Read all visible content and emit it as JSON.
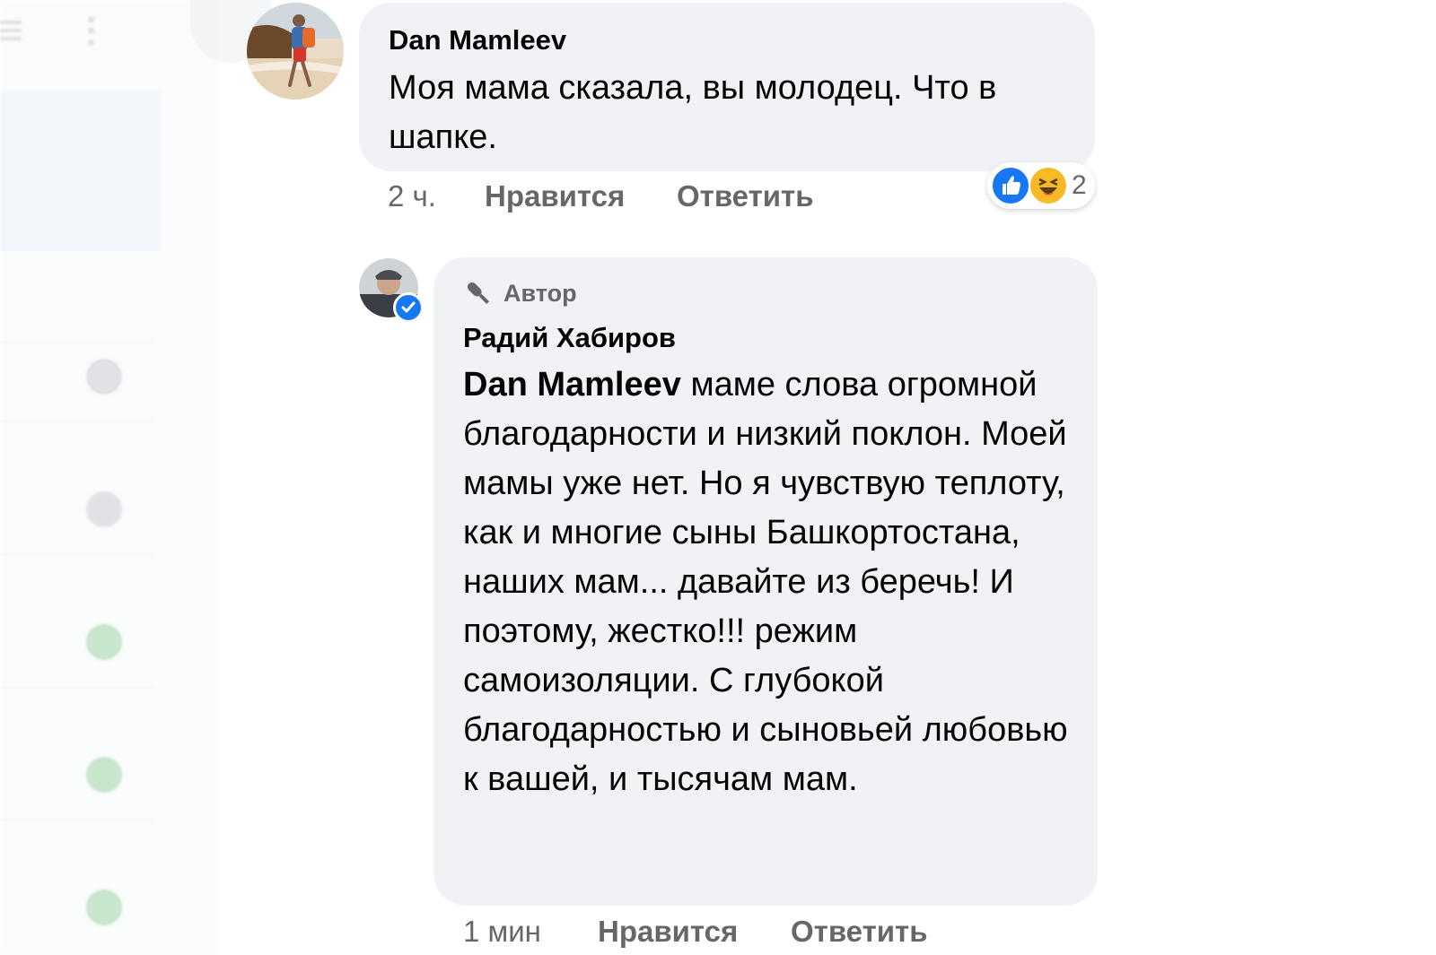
{
  "comment1": {
    "author": "Dan Mamleev",
    "text": "Моя мама сказала, вы молодец. Что в шапке.",
    "time": "2 ч.",
    "like_label": "Нравится",
    "reply_label": "Ответить",
    "reactions": {
      "icons": [
        "like-icon",
        "haha-icon"
      ],
      "count": "2"
    }
  },
  "comment2": {
    "badge": "Автор",
    "author": "Радий Хабиров",
    "mention": "Dan Mamleev",
    "text": "маме слова огромной благодарности и низкий поклон. Моей мамы уже нет. Но я чувствую теплоту, как и многие сыны Башкортостана, наших мам... давайте из беречь! И поэтому, жестко!!! режим самоизоляции. С глубокой благодарностью и сыновьей любовью к вашей, и тысячам мам.",
    "time": "1 мин",
    "like_label": "Нравится",
    "reply_label": "Ответить"
  },
  "colors": {
    "bubble": "#f0f2f5",
    "like_blue": "#1877f2",
    "haha_yellow": "#f7b928",
    "meta_gray": "#65676b"
  }
}
